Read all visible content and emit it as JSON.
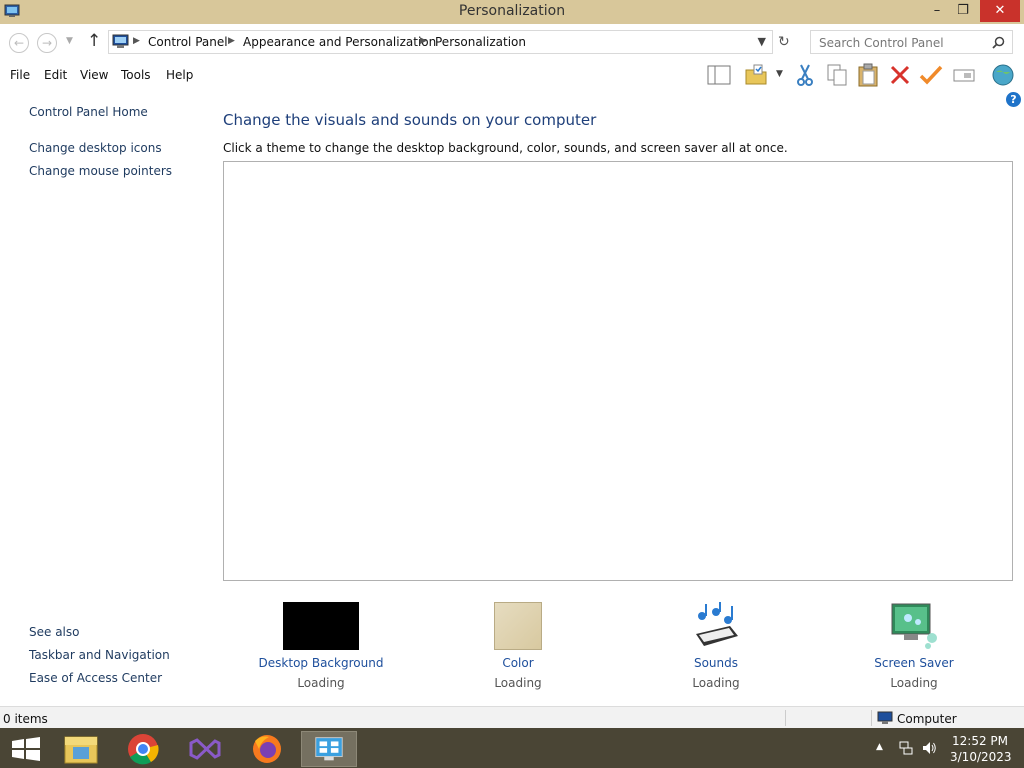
{
  "window": {
    "title": "Personalization"
  },
  "address": {
    "crumbs": [
      "Control Panel",
      "Appearance and Personalization",
      "Personalization"
    ],
    "search_placeholder": "Search Control Panel"
  },
  "menu": [
    "File",
    "Edit",
    "View",
    "Tools",
    "Help"
  ],
  "leftnav": {
    "home": "Control Panel Home",
    "links": [
      "Change desktop icons",
      "Change mouse pointers"
    ],
    "see_also_label": "See also",
    "see_also": [
      "Taskbar and Navigation",
      "Ease of Access Center"
    ]
  },
  "main": {
    "heading": "Change the visuals and sounds on your computer",
    "description": "Click a theme to change the desktop background, color, sounds, and screen saver all at once."
  },
  "settings": [
    {
      "label": "Desktop Background",
      "status": "Loading"
    },
    {
      "label": "Color",
      "status": "Loading"
    },
    {
      "label": "Sounds",
      "status": "Loading"
    },
    {
      "label": "Screen Saver",
      "status": "Loading"
    }
  ],
  "status": {
    "items": "0 items",
    "location": "Computer"
  },
  "taskbar": {
    "apps": [
      "start-icon",
      "file-explorer-icon",
      "chrome-icon",
      "visual-studio-icon",
      "firefox-icon",
      "personalization-icon"
    ],
    "time": "12:52 PM",
    "date": "3/10/2023"
  },
  "colors": {
    "titlebar": "#d8c79a",
    "taskbar": "#4a4535",
    "link": "#1e4f9c",
    "close": "#c9322b"
  }
}
